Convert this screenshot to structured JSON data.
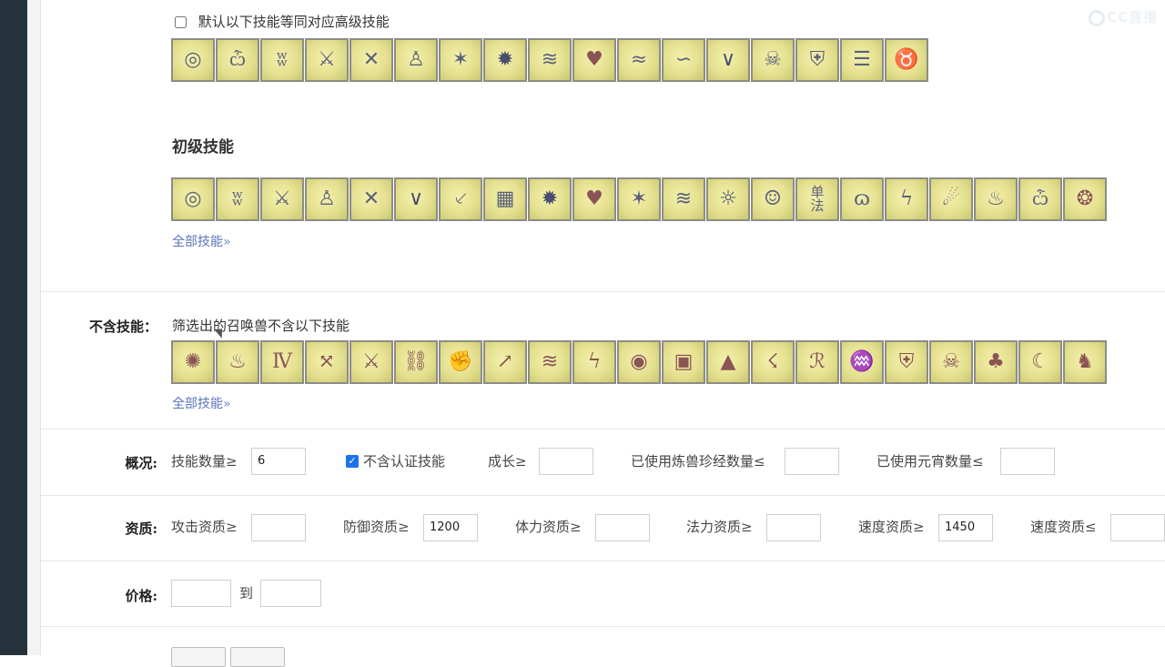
{
  "watermark": "CC直播",
  "default_advanced": {
    "label": "默认以下技能等同对应高级技能",
    "checked": false,
    "icons": [
      "eye-icon",
      "owl-icon",
      "mouth-icon",
      "sword-icon",
      "crossed-swords-icon",
      "figure-icon",
      "lightning-burst-icon",
      "explosion-icon",
      "signal-wave-icon",
      "heart-shield-icon",
      "claw-icon",
      "wind-icon",
      "wing-icon",
      "skull-icon",
      "shield-icon",
      "scroll-icon",
      "mask-icon"
    ]
  },
  "basic_skills": {
    "title": "初级技能",
    "link": "全部技能»",
    "icons": [
      "eye-icon",
      "mouth-icon",
      "sword-icon",
      "figure-icon",
      "crossed-swords-icon",
      "wing-icon",
      "blade-icon",
      "cage-icon",
      "explosion-icon",
      "heart-shield-icon",
      "lightning-burst-icon",
      "signal-wave-icon",
      "blast-icon",
      "ghost-icon",
      "single-spell-icon",
      "swirl-icon",
      "lightning-bolt-icon",
      "meteor-icon",
      "flame-icon",
      "owl-icon",
      "mandala-icon"
    ]
  },
  "excluded_skills": {
    "label": "不含技能：",
    "hint": "筛选出的召唤兽不含以下技能",
    "link": "全部技能»",
    "icons": [
      "seal-icon",
      "mountain-icon",
      "shield-wall-icon",
      "arrows-icon",
      "sword-dance-icon",
      "chain-icon",
      "fist-icon",
      "spear-icon",
      "rune-icon",
      "thunder-claw-icon",
      "eye-sigil-icon",
      "maze-icon",
      "pyramid-icon",
      "storm-icon",
      "glyph-icon",
      "dragon-icon",
      "guard-icon",
      "twin-skull-icon",
      "tree-icon",
      "crescent-icon",
      "dancer-icon"
    ],
    "icon_glyphs": [
      "✺",
      "♨",
      "Ⅳ",
      "⤧",
      "⚔",
      "⛓",
      "✊",
      "↗",
      "≋",
      "ϟ",
      "◉",
      "▣",
      "▲",
      "☇",
      "ℛ",
      "♒",
      "⛨",
      "☠",
      "♣",
      "☾",
      "♞"
    ]
  },
  "overview": {
    "label": "概况:",
    "skill_count_label": "技能数量≥",
    "skill_count_value": "6",
    "no_cert_label": "不含认证技能",
    "no_cert_checked": true,
    "growth_label": "成长≥",
    "growth_value": "",
    "beast_book_label": "已使用炼兽珍经数量≤",
    "beast_book_value": "",
    "yuanxiao_label": "已使用元宵数量≤",
    "yuanxiao_value": ""
  },
  "aptitude": {
    "label": "资质:",
    "attack_label": "攻击资质≥",
    "attack_value": "",
    "defense_label": "防御资质≥",
    "defense_value": "1200",
    "stamina_label": "体力资质≥",
    "stamina_value": "",
    "magic_label": "法力资质≥",
    "magic_value": "",
    "speed_min_label": "速度资质≥",
    "speed_min_value": "1450",
    "speed_max_label": "速度资质≤",
    "speed_max_value": ""
  },
  "price": {
    "label": "价格:",
    "min_value": "",
    "to_label": "到",
    "max_value": ""
  },
  "colors": {
    "link": "#5a75b8",
    "icon_bg": "#e5e08f",
    "checkbox": "#1a73e8"
  }
}
